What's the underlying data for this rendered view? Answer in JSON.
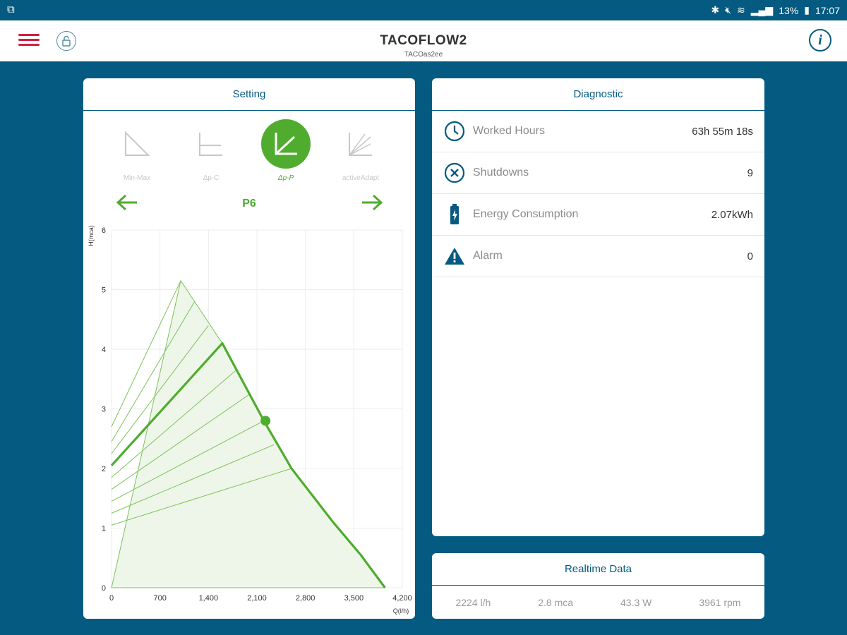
{
  "status": {
    "battery": "13%",
    "time": "17:07"
  },
  "app": {
    "title": "TACOFLOW2",
    "subtitle": "TACOas2ee"
  },
  "setting": {
    "header": "Setting",
    "modes": [
      {
        "label": "Min-Max",
        "icon": "min-max-icon"
      },
      {
        "label": "Δp-C",
        "icon": "dp-c-icon"
      },
      {
        "label": "Δp-P",
        "icon": "dp-p-icon"
      },
      {
        "label": "activeAdapt",
        "icon": "active-adapt-icon"
      }
    ],
    "selected_mode": "Δp-P",
    "preset": "P6",
    "colors": {
      "accent": "#4fac2e",
      "primary": "#045a80"
    }
  },
  "chart_data": {
    "type": "line",
    "ylabel": "H(mca)",
    "xlabel": "Q(l/h)",
    "xlim": [
      0,
      4200
    ],
    "ylim": [
      0,
      6
    ],
    "x_ticks": [
      "0",
      "700",
      "1,400",
      "2,100",
      "2,800",
      "3,500",
      "4,200"
    ],
    "y_ticks": [
      "0",
      "1",
      "2",
      "3",
      "4",
      "5",
      "6"
    ],
    "max_curve": [
      [
        0,
        0
      ],
      [
        1000,
        5.15
      ],
      [
        1200,
        4.8
      ],
      [
        1600,
        4.1
      ],
      [
        2200,
        2.8
      ],
      [
        2600,
        2.0
      ],
      [
        3200,
        1.1
      ],
      [
        3600,
        0.55
      ],
      [
        3950,
        0
      ]
    ],
    "preset_lines": [
      [
        [
          0,
          1.05
        ],
        [
          2600,
          2.0
        ]
      ],
      [
        [
          0,
          1.25
        ],
        [
          2350,
          2.4
        ]
      ],
      [
        [
          0,
          1.45
        ],
        [
          2200,
          2.8
        ]
      ],
      [
        [
          0,
          1.65
        ],
        [
          2000,
          3.25
        ]
      ],
      [
        [
          0,
          1.85
        ],
        [
          1800,
          3.65
        ]
      ],
      [
        [
          0,
          2.25
        ],
        [
          1400,
          4.4
        ]
      ],
      [
        [
          0,
          2.45
        ],
        [
          1200,
          4.8
        ]
      ],
      [
        [
          0,
          2.7
        ],
        [
          1000,
          5.15
        ]
      ]
    ],
    "selected_line": [
      [
        0,
        2.05
      ],
      [
        1600,
        4.1
      ],
      [
        2200,
        2.8
      ],
      [
        2600,
        2.0
      ],
      [
        3200,
        1.1
      ],
      [
        3600,
        0.55
      ],
      [
        3950,
        0
      ]
    ],
    "operating_point": [
      2224,
      2.8
    ]
  },
  "diagnostic": {
    "header": "Diagnostic",
    "rows": [
      {
        "label": "Worked Hours",
        "value": "63h 55m 18s",
        "icon": "clock-icon"
      },
      {
        "label": "Shutdowns",
        "value": "9",
        "icon": "close-circle-icon"
      },
      {
        "label": "Energy Consumption",
        "value": "2.07kWh",
        "icon": "battery-icon"
      },
      {
        "label": "Alarm",
        "value": "0",
        "icon": "warning-icon"
      }
    ]
  },
  "realtime": {
    "header": "Realtime Data",
    "flow": "2224 l/h",
    "head": "2.8 mca",
    "power": "43.3 W",
    "speed": "3961 rpm"
  }
}
